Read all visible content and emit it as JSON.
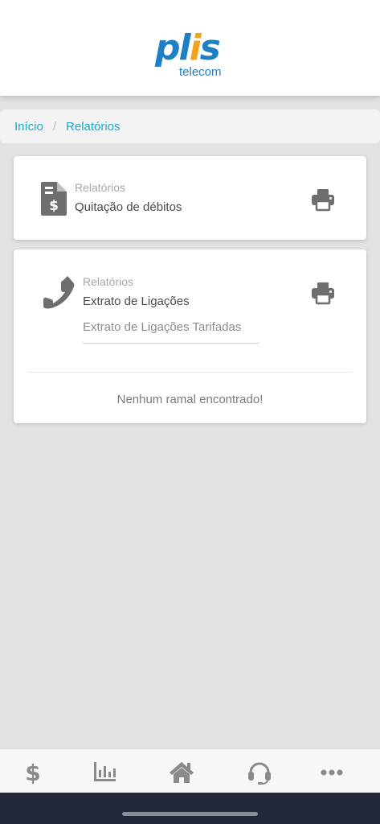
{
  "brand": {
    "logo_main_a": "pl",
    "logo_main_b": "i",
    "logo_main_c": "s",
    "logo_sub": "telecom",
    "colors": {
      "primary": "#1f7fc4",
      "accent": "#f4a11d"
    }
  },
  "breadcrumb": {
    "home": "Início",
    "separator": "/",
    "current": "Relatórios",
    "link_color": "#19a7c8"
  },
  "cards": [
    {
      "icon": "invoice-dollar-icon",
      "category": "Relatórios",
      "title": "Quitação de débitos",
      "action_icon": "print-icon"
    },
    {
      "icon": "phone-icon",
      "category": "Relatórios",
      "title": "Extrato de Ligações",
      "select_value": "Extrato de Ligações Tarifadas",
      "empty_message": "Nenhum ramal encontrado!",
      "action_icon": "print-icon"
    }
  ],
  "bottom_nav": [
    {
      "icon": "dollar-icon"
    },
    {
      "icon": "bar-chart-icon"
    },
    {
      "icon": "home-icon"
    },
    {
      "icon": "headset-icon"
    },
    {
      "icon": "more-icon"
    }
  ]
}
